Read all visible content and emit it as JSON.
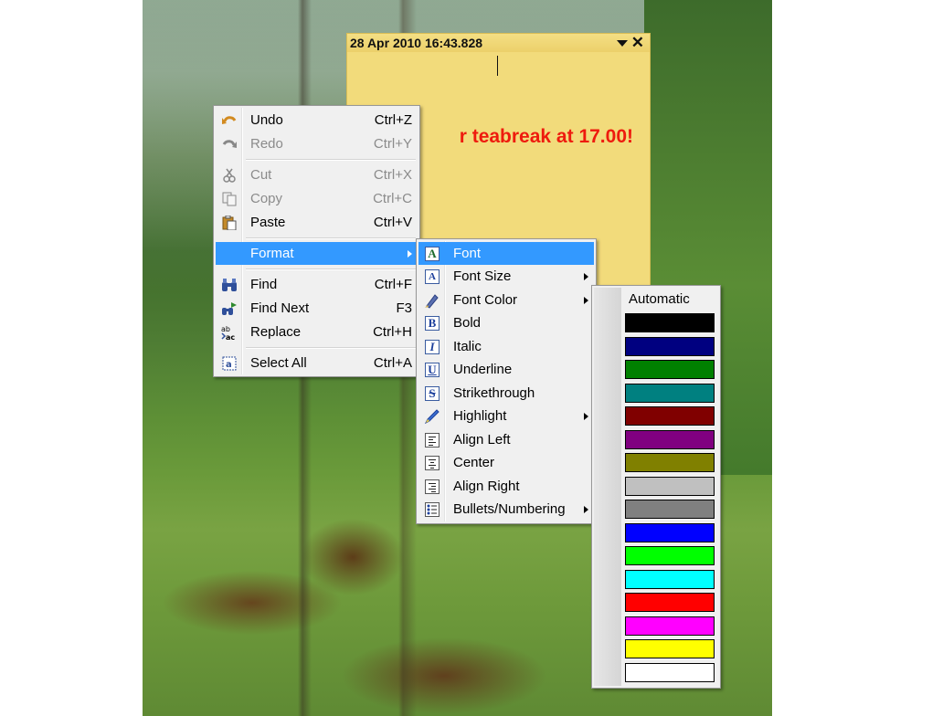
{
  "note": {
    "timestamp": "28 Apr 2010  16:43.828",
    "text": "r teabreak at 17.00!",
    "text_color": "#ee1b0e",
    "background": "#f2db7b"
  },
  "context_menu": {
    "items": [
      {
        "label": "Undo",
        "shortcut": "Ctrl+Z",
        "icon": "undo-icon",
        "enabled": true
      },
      {
        "label": "Redo",
        "shortcut": "Ctrl+Y",
        "icon": "redo-icon",
        "enabled": false
      },
      {
        "label": "Cut",
        "shortcut": "Ctrl+X",
        "icon": "cut-icon",
        "enabled": false
      },
      {
        "label": "Copy",
        "shortcut": "Ctrl+C",
        "icon": "copy-icon",
        "enabled": false
      },
      {
        "label": "Paste",
        "shortcut": "Ctrl+V",
        "icon": "paste-icon",
        "enabled": true
      },
      {
        "label": "Format",
        "shortcut": "",
        "icon": "",
        "enabled": true,
        "submenu": true,
        "highlighted": true
      },
      {
        "label": "Find",
        "shortcut": "Ctrl+F",
        "icon": "binoculars-icon",
        "enabled": true
      },
      {
        "label": "Find Next",
        "shortcut": "F3",
        "icon": "find-next-icon",
        "enabled": true
      },
      {
        "label": "Replace",
        "shortcut": "Ctrl+H",
        "icon": "replace-icon",
        "enabled": true
      },
      {
        "label": "Select All",
        "shortcut": "Ctrl+A",
        "icon": "select-all-icon",
        "enabled": true
      }
    ]
  },
  "format_menu": {
    "items": [
      {
        "label": "Font",
        "icon": "font-icon",
        "highlighted": true
      },
      {
        "label": "Font Size",
        "icon": "font-size-icon",
        "submenu": true
      },
      {
        "label": "Font Color",
        "icon": "font-color-icon",
        "submenu": true
      },
      {
        "label": "Bold",
        "icon": "bold-icon",
        "glyph": "B"
      },
      {
        "label": "Italic",
        "icon": "italic-icon",
        "glyph": "I"
      },
      {
        "label": "Underline",
        "icon": "underline-icon",
        "glyph": "U"
      },
      {
        "label": "Strikethrough",
        "icon": "strikethrough-icon",
        "glyph": "S"
      },
      {
        "label": "Highlight",
        "icon": "highlight-icon",
        "submenu": true
      },
      {
        "label": "Align Left",
        "icon": "align-left-icon"
      },
      {
        "label": "Center",
        "icon": "align-center-icon"
      },
      {
        "label": "Align Right",
        "icon": "align-right-icon"
      },
      {
        "label": "Bullets/Numbering",
        "icon": "bullets-icon",
        "submenu": true
      }
    ]
  },
  "color_menu": {
    "automatic_label": "Automatic",
    "colors": [
      "#000000",
      "#000080",
      "#008000",
      "#008080",
      "#800000",
      "#800080",
      "#808000",
      "#c0c0c0",
      "#808080",
      "#0000ff",
      "#00ff00",
      "#00ffff",
      "#ff0000",
      "#ff00ff",
      "#ffff00",
      "#ffffff"
    ]
  }
}
